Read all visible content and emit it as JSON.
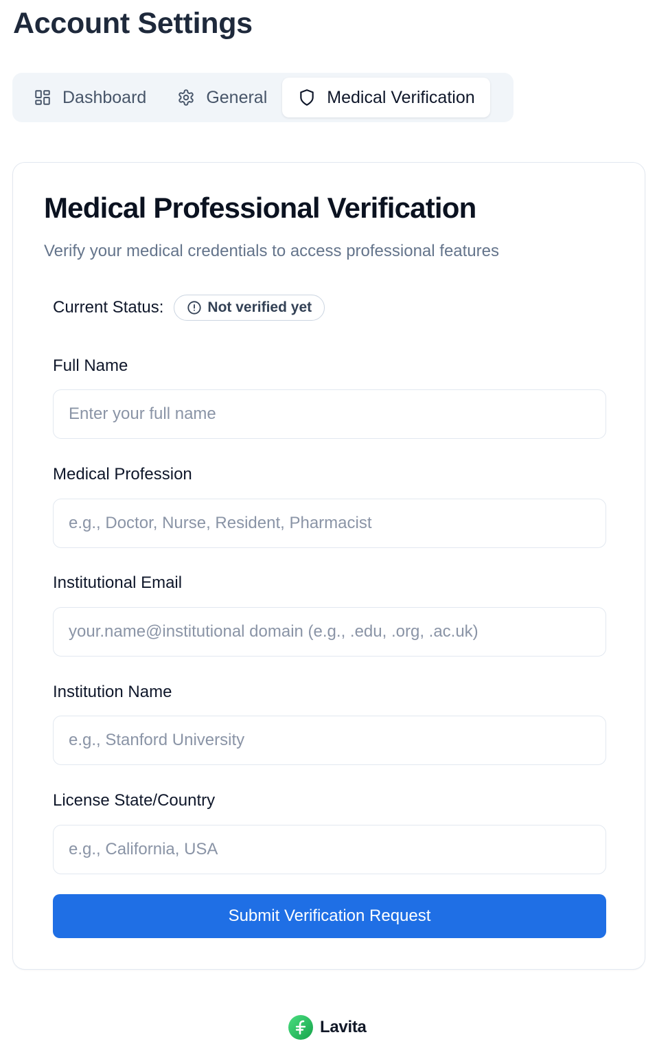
{
  "page": {
    "title": "Account Settings"
  },
  "tabs": [
    {
      "label": "Dashboard",
      "icon": "dashboard-grid-icon",
      "active": false
    },
    {
      "label": "General",
      "icon": "gear-icon",
      "active": false
    },
    {
      "label": "Medical Verification",
      "icon": "shield-icon",
      "active": true
    }
  ],
  "card": {
    "title": "Medical Professional Verification",
    "subtitle": "Verify your medical credentials to access professional features"
  },
  "status": {
    "label": "Current Status:",
    "badge": "Not verified yet",
    "icon": "alert-circle-icon"
  },
  "form": {
    "full_name": {
      "label": "Full Name",
      "placeholder": "Enter your full name",
      "value": ""
    },
    "profession": {
      "label": "Medical Profession",
      "placeholder": "e.g., Doctor, Nurse, Resident, Pharmacist",
      "value": ""
    },
    "email": {
      "label": "Institutional Email",
      "placeholder": "your.name@institutional domain (e.g., .edu, .org, .ac.uk)",
      "value": ""
    },
    "institution": {
      "label": "Institution Name",
      "placeholder": "e.g., Stanford University",
      "value": ""
    },
    "license": {
      "label": "License State/Country",
      "placeholder": "e.g., California, USA",
      "value": ""
    },
    "submit_label": "Submit Verification Request"
  },
  "footer": {
    "brand": "Lavita",
    "brand_icon": "lavita-logo-icon"
  },
  "colors": {
    "primary": "#1f6fe5",
    "tab_bg": "#f1f5f9",
    "border": "#e2e8f0",
    "muted_text": "#64748b",
    "logo_green": "#22c55e"
  }
}
